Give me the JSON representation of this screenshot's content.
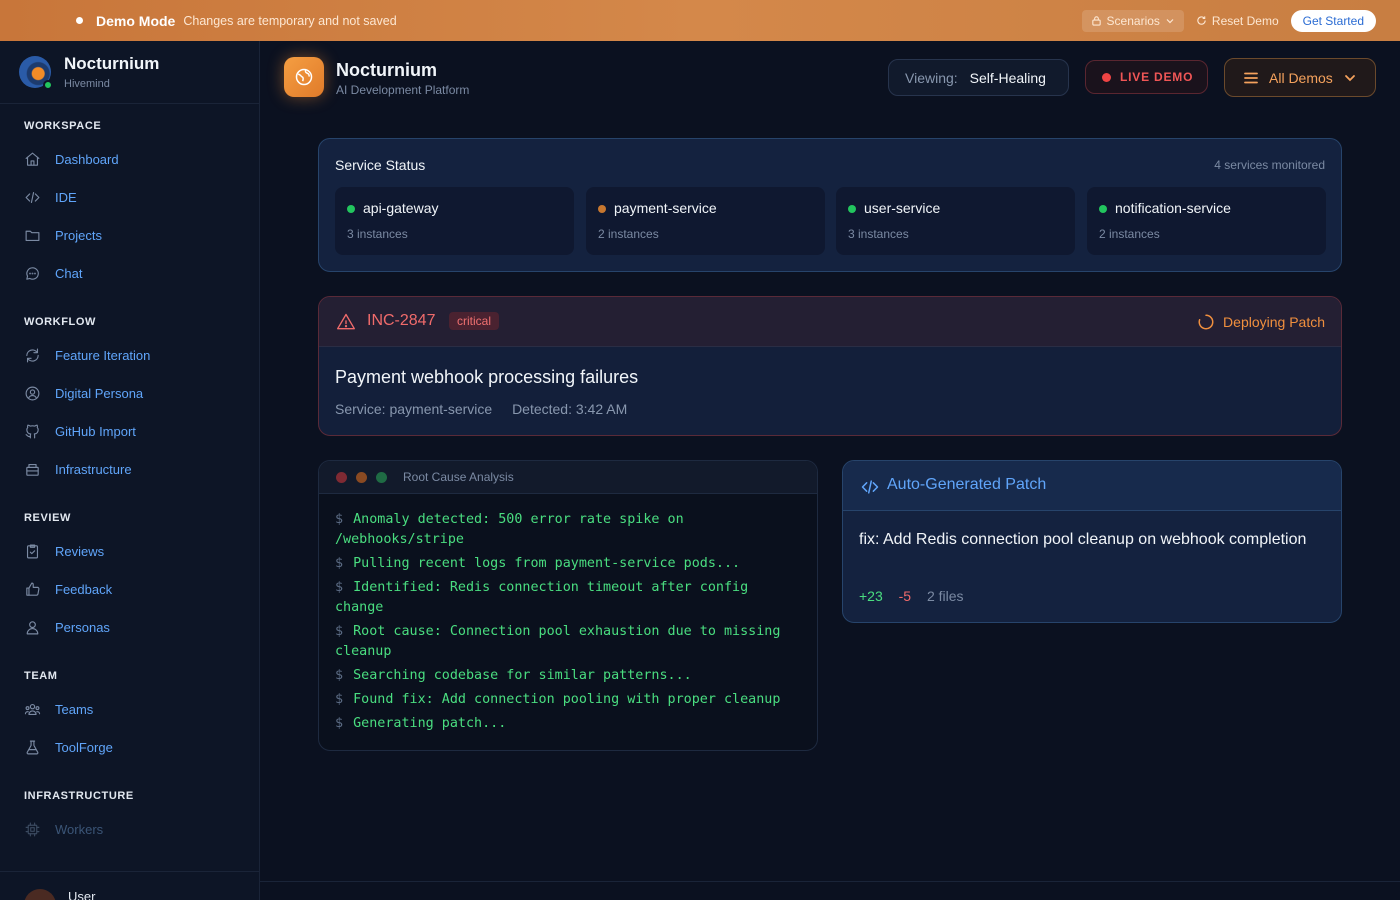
{
  "banner": {
    "mode": "Demo Mode",
    "message": "Changes are temporary and not saved",
    "scenarios_label": "Scenarios",
    "reset_label": "Reset Demo",
    "get_started_label": "Get Started"
  },
  "sidebar": {
    "brand_name": "Nocturnium",
    "brand_sub": "Hivemind",
    "sections": [
      {
        "title": "WORKSPACE",
        "items": [
          "Dashboard",
          "IDE",
          "Projects",
          "Chat"
        ]
      },
      {
        "title": "WORKFLOW",
        "items": [
          "Feature Iteration",
          "Digital Persona",
          "GitHub Import",
          "Infrastructure"
        ]
      },
      {
        "title": "REVIEW",
        "items": [
          "Reviews",
          "Feedback",
          "Personas"
        ]
      },
      {
        "title": "TEAM",
        "items": [
          "Teams",
          "ToolForge"
        ]
      },
      {
        "title": "INFRASTRUCTURE",
        "items": [
          "Workers"
        ]
      }
    ],
    "user_name": "User"
  },
  "header": {
    "title": "Nocturnium",
    "subtitle": "AI Development Platform",
    "viewing_label": "Viewing:",
    "viewing_value": "Self-Healing",
    "live_label": "LIVE DEMO",
    "all_demos_label": "All Demos"
  },
  "service_status": {
    "title": "Service Status",
    "meta": "4 services monitored",
    "services": [
      {
        "name": "api-gateway",
        "instances": "3 instances",
        "status_color": "#22c55e"
      },
      {
        "name": "payment-service",
        "instances": "2 instances",
        "status_color": "#c7772f"
      },
      {
        "name": "user-service",
        "instances": "3 instances",
        "status_color": "#22c55e"
      },
      {
        "name": "notification-service",
        "instances": "2 instances",
        "status_color": "#22c55e"
      }
    ]
  },
  "incident": {
    "id": "INC-2847",
    "severity": "critical",
    "status": "Deploying Patch",
    "title": "Payment webhook processing failures",
    "service": "Service: payment-service",
    "detected": "Detected: 3:42 AM"
  },
  "terminal": {
    "title": "Root Cause Analysis",
    "prompt": "$",
    "lines": [
      "Anomaly detected: 500 error rate spike on /webhooks/stripe",
      "Pulling recent logs from payment-service pods...",
      "Identified: Redis connection timeout after config change",
      "Root cause: Connection pool exhaustion due to missing cleanup",
      "Searching codebase for similar patterns...",
      "Found fix: Add connection pooling with proper cleanup",
      "Generating patch..."
    ]
  },
  "patch": {
    "title": "Auto-Generated Patch",
    "description": "fix: Add Redis connection pool cleanup on webhook completion",
    "additions": "+23",
    "deletions": "-5",
    "files": "2 files"
  }
}
